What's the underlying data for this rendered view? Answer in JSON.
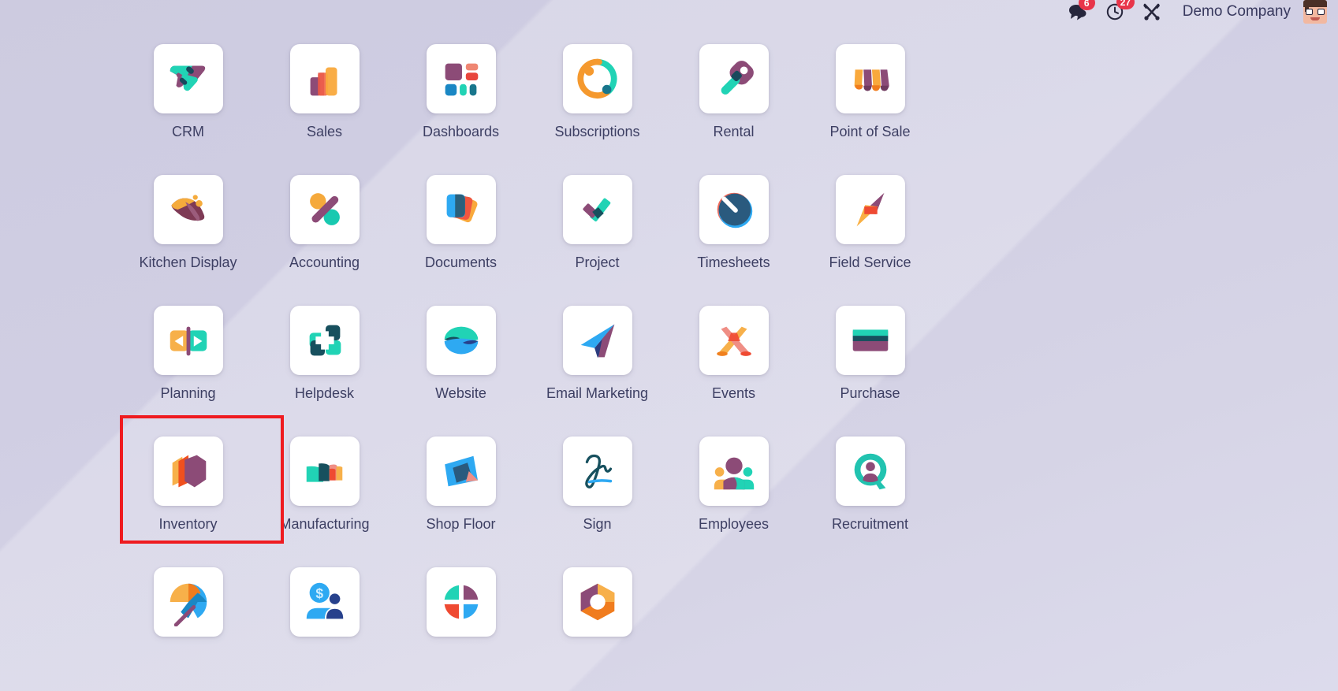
{
  "topbar": {
    "messages": {
      "icon": "chat-bubble-icon",
      "count": "6"
    },
    "activities": {
      "icon": "clock-icon",
      "count": "27"
    },
    "tools": {
      "icon": "crossed-tools-icon"
    },
    "company": "Demo Company",
    "avatar": {
      "icon": "user-avatar"
    }
  },
  "colors": {
    "background_top": "#cdcbe0",
    "background_bottom": "#dcdbec",
    "tile_background": "#ffffff",
    "label_text": "#3d3f63",
    "badge": "#e8354a",
    "highlight_border": "#ef1b20"
  },
  "highlight": {
    "target_app": "Inventory"
  },
  "apps": [
    {
      "label": "CRM",
      "icon": "crm-icon"
    },
    {
      "label": "Sales",
      "icon": "sales-icon"
    },
    {
      "label": "Dashboards",
      "icon": "dashboards-icon"
    },
    {
      "label": "Subscriptions",
      "icon": "subscriptions-icon"
    },
    {
      "label": "Rental",
      "icon": "rental-icon"
    },
    {
      "label": "Point of Sale",
      "icon": "point-of-sale-icon"
    },
    {
      "label": "Kitchen Display",
      "icon": "kitchen-display-icon"
    },
    {
      "label": "Accounting",
      "icon": "accounting-icon"
    },
    {
      "label": "Documents",
      "icon": "documents-icon"
    },
    {
      "label": "Project",
      "icon": "project-icon"
    },
    {
      "label": "Timesheets",
      "icon": "timesheets-icon"
    },
    {
      "label": "Field Service",
      "icon": "field-service-icon"
    },
    {
      "label": "Planning",
      "icon": "planning-icon"
    },
    {
      "label": "Helpdesk",
      "icon": "helpdesk-icon"
    },
    {
      "label": "Website",
      "icon": "website-icon"
    },
    {
      "label": "Email Marketing",
      "icon": "email-marketing-icon"
    },
    {
      "label": "Events",
      "icon": "events-icon"
    },
    {
      "label": "Purchase",
      "icon": "purchase-icon"
    },
    {
      "label": "Inventory",
      "icon": "inventory-icon"
    },
    {
      "label": "Manufacturing",
      "icon": "manufacturing-icon"
    },
    {
      "label": "Shop Floor",
      "icon": "shop-floor-icon"
    },
    {
      "label": "Sign",
      "icon": "sign-icon"
    },
    {
      "label": "Employees",
      "icon": "employees-icon"
    },
    {
      "label": "Recruitment",
      "icon": "recruitment-icon"
    },
    {
      "label": "",
      "icon": "umbrella-icon"
    },
    {
      "label": "",
      "icon": "payroll-icon"
    },
    {
      "label": "",
      "icon": "quadrant-circle-icon"
    },
    {
      "label": "",
      "icon": "hexagon-gear-icon"
    }
  ]
}
